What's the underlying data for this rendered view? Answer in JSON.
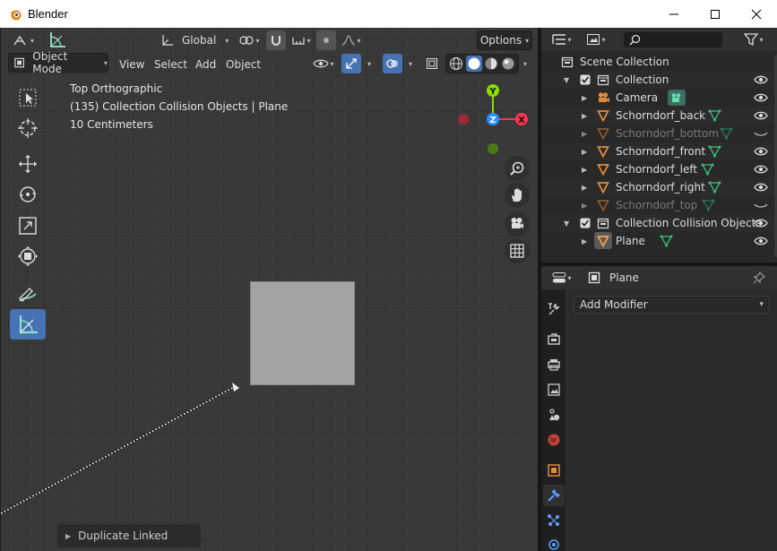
{
  "window": {
    "title": "Blender"
  },
  "viewport_header": {
    "transform_orientation": "Global",
    "options_label": "Options",
    "mode": "Object Mode",
    "menus": [
      "View",
      "Select",
      "Add",
      "Object"
    ]
  },
  "viewport_overlay": {
    "view_name": "Top Orthographic",
    "collection_info": "(135) Collection Collision Objects | Plane",
    "grid_scale": "10 Centimeters"
  },
  "gizmo": {
    "y": "Y",
    "z": "Z",
    "x": "X"
  },
  "redo_panel": {
    "label": "Duplicate Linked"
  },
  "outliner": {
    "root": "Scene Collection",
    "rows": [
      {
        "label": "Collection",
        "dim": false
      },
      {
        "label": "Camera",
        "dim": false
      },
      {
        "label": "Schorndorf_back",
        "dim": false
      },
      {
        "label": "Schorndorf_bottom",
        "dim": true
      },
      {
        "label": "Schorndorf_front",
        "dim": false
      },
      {
        "label": "Schorndorf_left",
        "dim": false
      },
      {
        "label": "Schorndorf_right",
        "dim": false
      },
      {
        "label": "Schorndorf_top",
        "dim": true
      },
      {
        "label": "Collection Collision Objects",
        "dim": false
      },
      {
        "label": "Plane",
        "dim": false
      }
    ]
  },
  "properties": {
    "object_name": "Plane",
    "add_modifier_label": "Add Modifier"
  },
  "colors": {
    "accent_blue": "#4772b3",
    "object_orange": "#e08a3c",
    "mesh_green": "#36c27a",
    "axis_x": "#ff3352",
    "axis_y": "#8bdc00",
    "axis_z": "#2890ff"
  }
}
